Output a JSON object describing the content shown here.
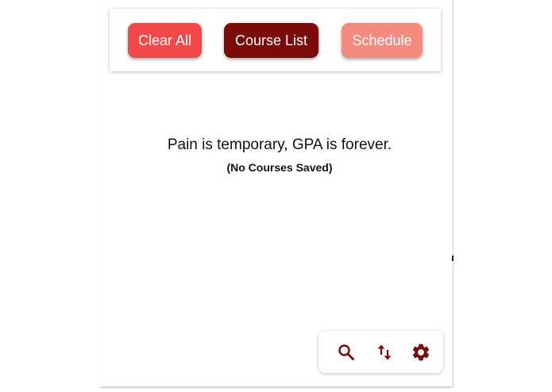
{
  "toolbar": {
    "clear_label": "Clear All",
    "course_list_label": "Course List",
    "schedule_label": "Schedule"
  },
  "main": {
    "quote": "Pain is temporary, GPA is forever.",
    "empty_state": "(No Courses Saved)"
  },
  "actions": {
    "icons": [
      "search-icon",
      "sort-icon",
      "gear-icon"
    ]
  },
  "colors": {
    "clear_button": "#f2484a",
    "course_list_button": "#7b0b09",
    "schedule_button": "#f58a7f",
    "icon_color": "#7b0b09"
  }
}
